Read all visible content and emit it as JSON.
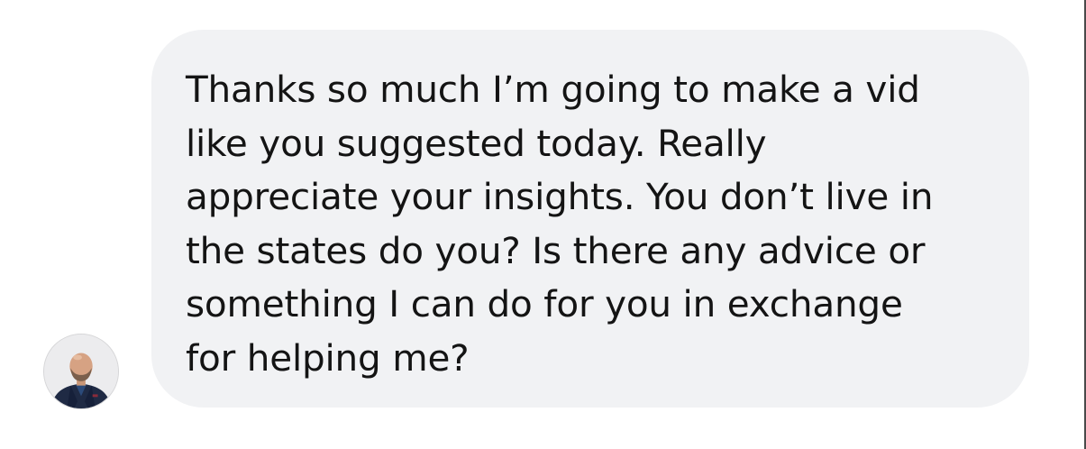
{
  "conversation": {
    "message": {
      "text": "Thanks so much I’m going to make a vid\nlike you suggested today. Really\nappreciate your insights. You don’t live in\nthe states do you? Is there any advice or\nsomething I can do for you in exchange\nfor helping me?",
      "bubble_color": "#f1f2f4",
      "text_color": "#141414"
    },
    "sender": {
      "avatar_icon": "person-avatar-icon"
    }
  }
}
